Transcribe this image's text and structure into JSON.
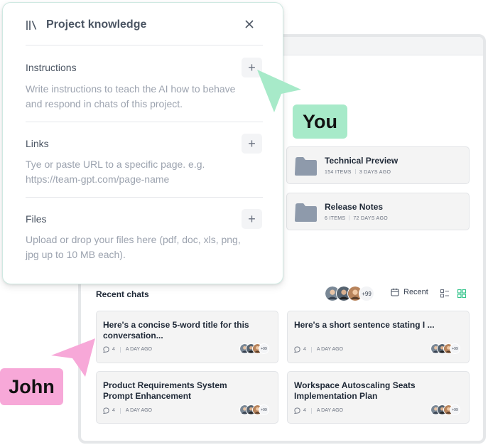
{
  "panel": {
    "title": "Project knowledge",
    "sections": [
      {
        "label": "Instructions",
        "description": "Write instructions to teach the AI how to behave and respond in chats of this project."
      },
      {
        "label": "Links",
        "description": "Tye or paste URL to a specific page. e.g. https://team-gpt.com/page-name"
      },
      {
        "label": "Files",
        "description": "Upload or drop your files here (pdf, doc, xls, png, jpg up to 10 MB each)."
      }
    ]
  },
  "folders": [
    {
      "title": "Technical Preview",
      "items": "154 ITEMS",
      "age": "3 DAYS AGO"
    },
    {
      "title": "Release Notes",
      "items": "6 ITEMS",
      "age": "72 DAYS AGO"
    }
  ],
  "recent": {
    "label": "Recent chats",
    "members_more": "+99",
    "sort_label": "Recent",
    "chats": [
      {
        "title": "Here's a concise 5-word title for this conversation...",
        "count": "4",
        "time": "A DAY AGO",
        "more": "+99"
      },
      {
        "title": "Here's a short sentence stating I ...",
        "count": "4",
        "time": "A DAY AGO",
        "more": "+99"
      },
      {
        "title": "Product Requirements System Prompt Enhancement",
        "count": "4",
        "time": "A DAY AGO",
        "more": "+99"
      },
      {
        "title": "Workspace Autoscaling Seats Implementation Plan",
        "count": "4",
        "time": "A DAY AGO",
        "more": "+99"
      }
    ]
  },
  "cursors": {
    "you": "You",
    "john": "John"
  },
  "colors": {
    "you_tag": "#a7eac9",
    "john_tag": "#f7a8d8",
    "grid_view_active": "#34c48b",
    "folder": "#8e9aab"
  },
  "icons": [
    "library-icon",
    "close-icon",
    "plus-icon",
    "folder-icon",
    "calendar-icon",
    "list-view-icon",
    "grid-view-icon",
    "chat-bubble-icon",
    "cursor-arrow-icon"
  ]
}
